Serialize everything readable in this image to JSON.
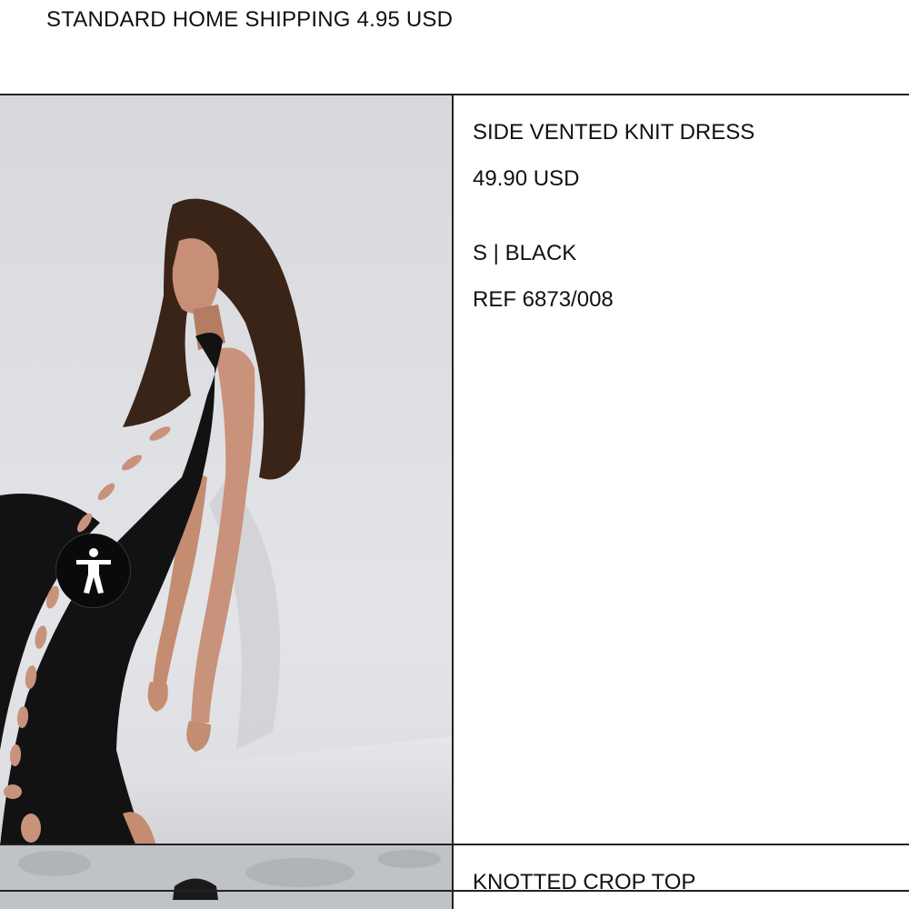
{
  "shipping_banner": "STANDARD HOME SHIPPING 4.95 USD",
  "items": [
    {
      "name": "SIDE VENTED KNIT DRESS",
      "price": "49.90 USD",
      "variant": "S | BLACK",
      "reference": "REF 6873/008",
      "image_icon": "product-photo-dress"
    },
    {
      "name": "KNOTTED CROP TOP",
      "image_icon": "product-photo-top"
    }
  ],
  "accessibility": {
    "icon": "accessibility-person-icon",
    "color": "#0a0a0a"
  }
}
